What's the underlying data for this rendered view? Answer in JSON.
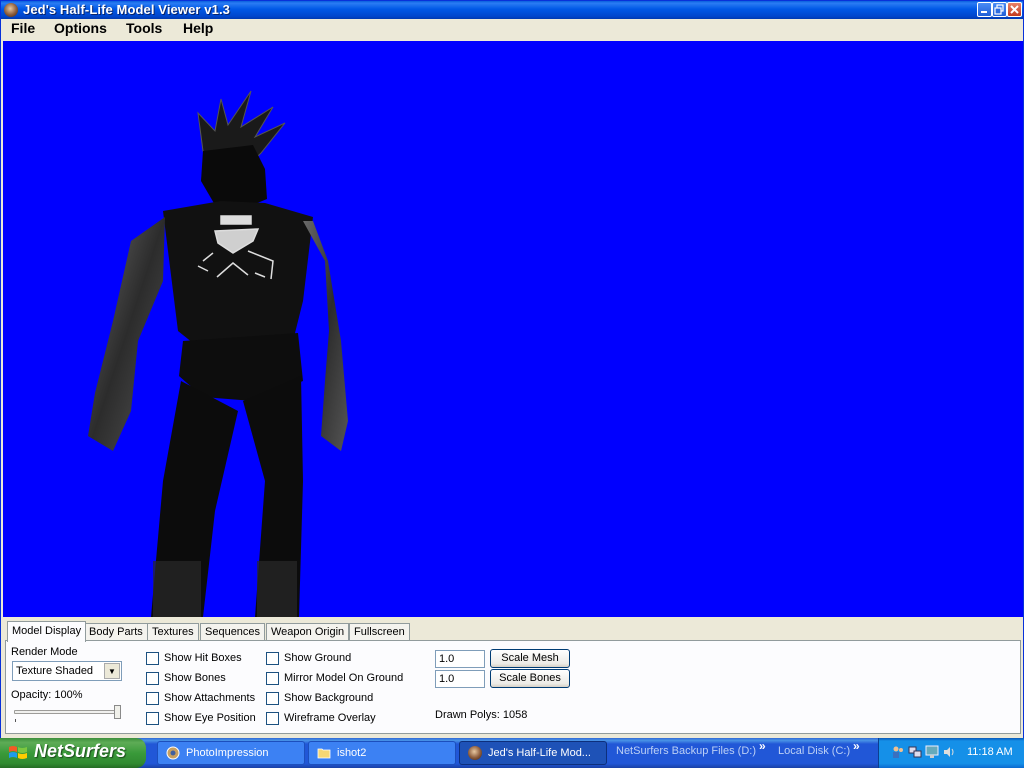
{
  "window": {
    "title": "Jed's Half-Life Model Viewer v1.3"
  },
  "menu": [
    "File",
    "Options",
    "Tools",
    "Help"
  ],
  "viewport": {
    "background_color": "#0000ff"
  },
  "tabs": [
    "Model Display",
    "Body Parts",
    "Textures",
    "Sequences",
    "Weapon Origin",
    "Fullscreen"
  ],
  "model_display": {
    "render_mode_label": "Render Mode",
    "render_mode_value": "Texture Shaded",
    "opacity_label": "Opacity: 100%",
    "opacity_value": 1.0,
    "checkboxes_col1": [
      "Show Hit Boxes",
      "Show Bones",
      "Show Attachments",
      "Show Eye Position"
    ],
    "checkboxes_col2": [
      "Show Ground",
      "Mirror Model On Ground",
      "Show Background",
      "Wireframe Overlay"
    ],
    "scale_mesh_value": "1.0",
    "scale_bones_value": "1.0",
    "scale_mesh_button": "Scale Mesh",
    "scale_bones_button": "Scale Bones",
    "drawn_polys": "Drawn Polys: 1058"
  },
  "taskbar": {
    "start_label": "NetSurfers",
    "tasks": [
      "PhotoImpression",
      "ishot2",
      "Jed's Half-Life Mod..."
    ],
    "toolbars": [
      "NetSurfers Backup Files (D:)",
      "Local Disk (C:)"
    ],
    "clock": "11:18 AM"
  }
}
